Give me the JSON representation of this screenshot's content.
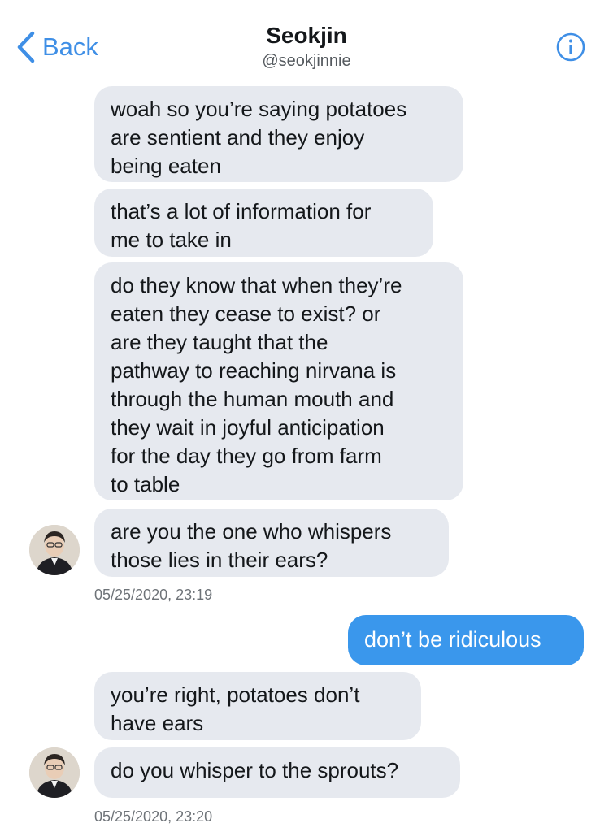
{
  "header": {
    "back_label": "Back",
    "contact_name": "Seokjin",
    "contact_handle": "@seokjinnie"
  },
  "colors": {
    "accent": "#3a97ec",
    "incoming_bubble": "#e6e9ef",
    "outgoing_bubble": "#3a97ec"
  },
  "messages": [
    {
      "direction": "incoming",
      "text": "woah so you’re saying potatoes\nare sentient and they enjoy\nbeing eaten"
    },
    {
      "direction": "incoming",
      "text": "that’s a lot of information for\nme to take in"
    },
    {
      "direction": "incoming",
      "text": "do they know that when they’re\neaten they cease to exist? or\nare they taught that the\npathway to reaching nirvana is\nthrough the human mouth and\nthey wait in joyful anticipation\nfor the day they go from farm\nto table"
    },
    {
      "direction": "incoming",
      "text": "are you the one who whispers\nthose lies in their ears?"
    },
    {
      "direction": "outgoing",
      "text": "don’t be ridiculous"
    },
    {
      "direction": "incoming",
      "text": "you’re right, potatoes don’t\nhave ears"
    },
    {
      "direction": "incoming",
      "text": "do you whisper to the sprouts?"
    }
  ],
  "timestamps": [
    "05/25/2020, 23:19",
    "05/25/2020, 23:20"
  ]
}
